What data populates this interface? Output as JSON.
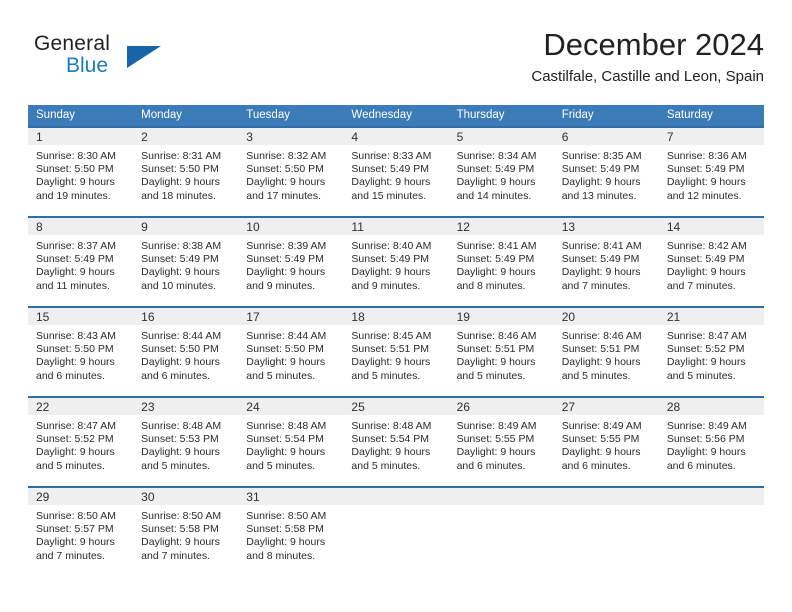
{
  "brand": {
    "name_part1": "General",
    "name_part2": "Blue",
    "logo_icon": "triangle-logo-icon",
    "accent_color": "#1565a8"
  },
  "header": {
    "title": "December 2024",
    "subtitle": "Castilfale, Castille and Leon, Spain"
  },
  "colors": {
    "header_row": "#3b7cb8",
    "week_divider": "#2f6ca8",
    "day_band": "#efefef",
    "brand_blue": "#1c7cc0"
  },
  "weekdays": [
    {
      "label": "Sunday"
    },
    {
      "label": "Monday"
    },
    {
      "label": "Tuesday"
    },
    {
      "label": "Wednesday"
    },
    {
      "label": "Thursday"
    },
    {
      "label": "Friday"
    },
    {
      "label": "Saturday"
    }
  ],
  "weeks": [
    {
      "days": [
        {
          "num": "1",
          "line1": "Sunrise: 8:30 AM",
          "line2": "Sunset: 5:50 PM",
          "line3": "Daylight: 9 hours",
          "line4": "and 19 minutes."
        },
        {
          "num": "2",
          "line1": "Sunrise: 8:31 AM",
          "line2": "Sunset: 5:50 PM",
          "line3": "Daylight: 9 hours",
          "line4": "and 18 minutes."
        },
        {
          "num": "3",
          "line1": "Sunrise: 8:32 AM",
          "line2": "Sunset: 5:50 PM",
          "line3": "Daylight: 9 hours",
          "line4": "and 17 minutes."
        },
        {
          "num": "4",
          "line1": "Sunrise: 8:33 AM",
          "line2": "Sunset: 5:49 PM",
          "line3": "Daylight: 9 hours",
          "line4": "and 15 minutes."
        },
        {
          "num": "5",
          "line1": "Sunrise: 8:34 AM",
          "line2": "Sunset: 5:49 PM",
          "line3": "Daylight: 9 hours",
          "line4": "and 14 minutes."
        },
        {
          "num": "6",
          "line1": "Sunrise: 8:35 AM",
          "line2": "Sunset: 5:49 PM",
          "line3": "Daylight: 9 hours",
          "line4": "and 13 minutes."
        },
        {
          "num": "7",
          "line1": "Sunrise: 8:36 AM",
          "line2": "Sunset: 5:49 PM",
          "line3": "Daylight: 9 hours",
          "line4": "and 12 minutes."
        }
      ]
    },
    {
      "days": [
        {
          "num": "8",
          "line1": "Sunrise: 8:37 AM",
          "line2": "Sunset: 5:49 PM",
          "line3": "Daylight: 9 hours",
          "line4": "and 11 minutes."
        },
        {
          "num": "9",
          "line1": "Sunrise: 8:38 AM",
          "line2": "Sunset: 5:49 PM",
          "line3": "Daylight: 9 hours",
          "line4": "and 10 minutes."
        },
        {
          "num": "10",
          "line1": "Sunrise: 8:39 AM",
          "line2": "Sunset: 5:49 PM",
          "line3": "Daylight: 9 hours",
          "line4": "and 9 minutes."
        },
        {
          "num": "11",
          "line1": "Sunrise: 8:40 AM",
          "line2": "Sunset: 5:49 PM",
          "line3": "Daylight: 9 hours",
          "line4": "and 9 minutes."
        },
        {
          "num": "12",
          "line1": "Sunrise: 8:41 AM",
          "line2": "Sunset: 5:49 PM",
          "line3": "Daylight: 9 hours",
          "line4": "and 8 minutes."
        },
        {
          "num": "13",
          "line1": "Sunrise: 8:41 AM",
          "line2": "Sunset: 5:49 PM",
          "line3": "Daylight: 9 hours",
          "line4": "and 7 minutes."
        },
        {
          "num": "14",
          "line1": "Sunrise: 8:42 AM",
          "line2": "Sunset: 5:49 PM",
          "line3": "Daylight: 9 hours",
          "line4": "and 7 minutes."
        }
      ]
    },
    {
      "days": [
        {
          "num": "15",
          "line1": "Sunrise: 8:43 AM",
          "line2": "Sunset: 5:50 PM",
          "line3": "Daylight: 9 hours",
          "line4": "and 6 minutes."
        },
        {
          "num": "16",
          "line1": "Sunrise: 8:44 AM",
          "line2": "Sunset: 5:50 PM",
          "line3": "Daylight: 9 hours",
          "line4": "and 6 minutes."
        },
        {
          "num": "17",
          "line1": "Sunrise: 8:44 AM",
          "line2": "Sunset: 5:50 PM",
          "line3": "Daylight: 9 hours",
          "line4": "and 5 minutes."
        },
        {
          "num": "18",
          "line1": "Sunrise: 8:45 AM",
          "line2": "Sunset: 5:51 PM",
          "line3": "Daylight: 9 hours",
          "line4": "and 5 minutes."
        },
        {
          "num": "19",
          "line1": "Sunrise: 8:46 AM",
          "line2": "Sunset: 5:51 PM",
          "line3": "Daylight: 9 hours",
          "line4": "and 5 minutes."
        },
        {
          "num": "20",
          "line1": "Sunrise: 8:46 AM",
          "line2": "Sunset: 5:51 PM",
          "line3": "Daylight: 9 hours",
          "line4": "and 5 minutes."
        },
        {
          "num": "21",
          "line1": "Sunrise: 8:47 AM",
          "line2": "Sunset: 5:52 PM",
          "line3": "Daylight: 9 hours",
          "line4": "and 5 minutes."
        }
      ]
    },
    {
      "days": [
        {
          "num": "22",
          "line1": "Sunrise: 8:47 AM",
          "line2": "Sunset: 5:52 PM",
          "line3": "Daylight: 9 hours",
          "line4": "and 5 minutes."
        },
        {
          "num": "23",
          "line1": "Sunrise: 8:48 AM",
          "line2": "Sunset: 5:53 PM",
          "line3": "Daylight: 9 hours",
          "line4": "and 5 minutes."
        },
        {
          "num": "24",
          "line1": "Sunrise: 8:48 AM",
          "line2": "Sunset: 5:54 PM",
          "line3": "Daylight: 9 hours",
          "line4": "and 5 minutes."
        },
        {
          "num": "25",
          "line1": "Sunrise: 8:48 AM",
          "line2": "Sunset: 5:54 PM",
          "line3": "Daylight: 9 hours",
          "line4": "and 5 minutes."
        },
        {
          "num": "26",
          "line1": "Sunrise: 8:49 AM",
          "line2": "Sunset: 5:55 PM",
          "line3": "Daylight: 9 hours",
          "line4": "and 6 minutes."
        },
        {
          "num": "27",
          "line1": "Sunrise: 8:49 AM",
          "line2": "Sunset: 5:55 PM",
          "line3": "Daylight: 9 hours",
          "line4": "and 6 minutes."
        },
        {
          "num": "28",
          "line1": "Sunrise: 8:49 AM",
          "line2": "Sunset: 5:56 PM",
          "line3": "Daylight: 9 hours",
          "line4": "and 6 minutes."
        }
      ]
    },
    {
      "days": [
        {
          "num": "29",
          "line1": "Sunrise: 8:50 AM",
          "line2": "Sunset: 5:57 PM",
          "line3": "Daylight: 9 hours",
          "line4": "and 7 minutes."
        },
        {
          "num": "30",
          "line1": "Sunrise: 8:50 AM",
          "line2": "Sunset: 5:58 PM",
          "line3": "Daylight: 9 hours",
          "line4": "and 7 minutes."
        },
        {
          "num": "31",
          "line1": "Sunrise: 8:50 AM",
          "line2": "Sunset: 5:58 PM",
          "line3": "Daylight: 9 hours",
          "line4": "and 8 minutes."
        },
        {
          "num": "",
          "line1": "",
          "line2": "",
          "line3": "",
          "line4": ""
        },
        {
          "num": "",
          "line1": "",
          "line2": "",
          "line3": "",
          "line4": ""
        },
        {
          "num": "",
          "line1": "",
          "line2": "",
          "line3": "",
          "line4": ""
        },
        {
          "num": "",
          "line1": "",
          "line2": "",
          "line3": "",
          "line4": ""
        }
      ]
    }
  ]
}
